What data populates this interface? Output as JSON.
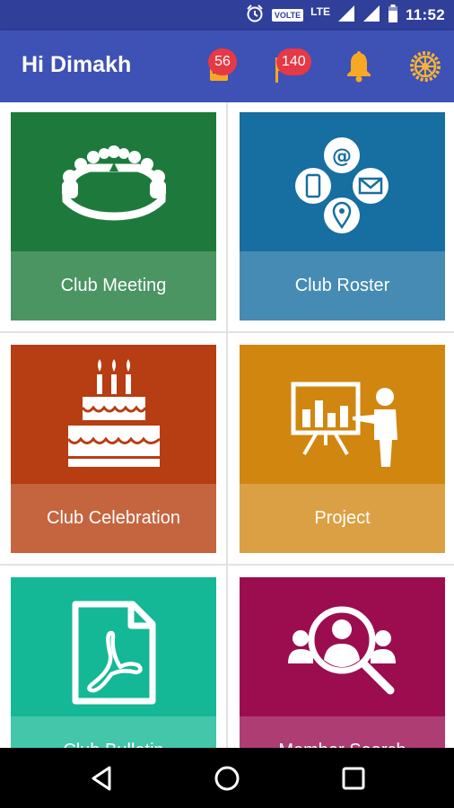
{
  "status_bar": {
    "time": "11:52",
    "volte": "VOLTE",
    "network": "LTE",
    "icons": [
      "alarm-icon",
      "signal-icon",
      "signal-icon",
      "battery-icon"
    ]
  },
  "app_bar": {
    "title": "Hi Dimakh",
    "actions": [
      {
        "icon": "notes-icon",
        "badge": "56"
      },
      {
        "icon": "flag-icon",
        "badge": "140"
      },
      {
        "icon": "bell-icon"
      },
      {
        "icon": "rotary-wheel-icon"
      }
    ]
  },
  "tiles": [
    {
      "label": "Club Meeting",
      "icon": "meeting-people-icon",
      "color": "#1e7a3c",
      "label_color": "#4b9563"
    },
    {
      "label": "Club Roster",
      "icon": "contact-channels-icon",
      "color": "#176ea0",
      "label_color": "#458bb3"
    },
    {
      "label": "Club Celebration",
      "icon": "birthday-cake-icon",
      "color": "#b73d12",
      "label_color": "#c5653f"
    },
    {
      "label": "Project",
      "icon": "presentation-icon",
      "color": "#d1860f",
      "label_color": "#dba044"
    },
    {
      "label": "Club Bulletin",
      "icon": "pdf-document-icon",
      "color": "#14b896",
      "label_color": "#43c6aa"
    },
    {
      "label": "Member Search",
      "icon": "member-search-icon",
      "color": "#9c0d50",
      "label_color": "#ae3d73"
    }
  ],
  "nav_bar": {
    "buttons": [
      "back-icon",
      "home-icon",
      "recents-icon"
    ]
  },
  "colors": {
    "status_bar": "#2f3f9a",
    "app_bar": "#3e51b5",
    "badge": "#e53946",
    "bell": "#f9a825",
    "rotary": "#f5b335"
  }
}
